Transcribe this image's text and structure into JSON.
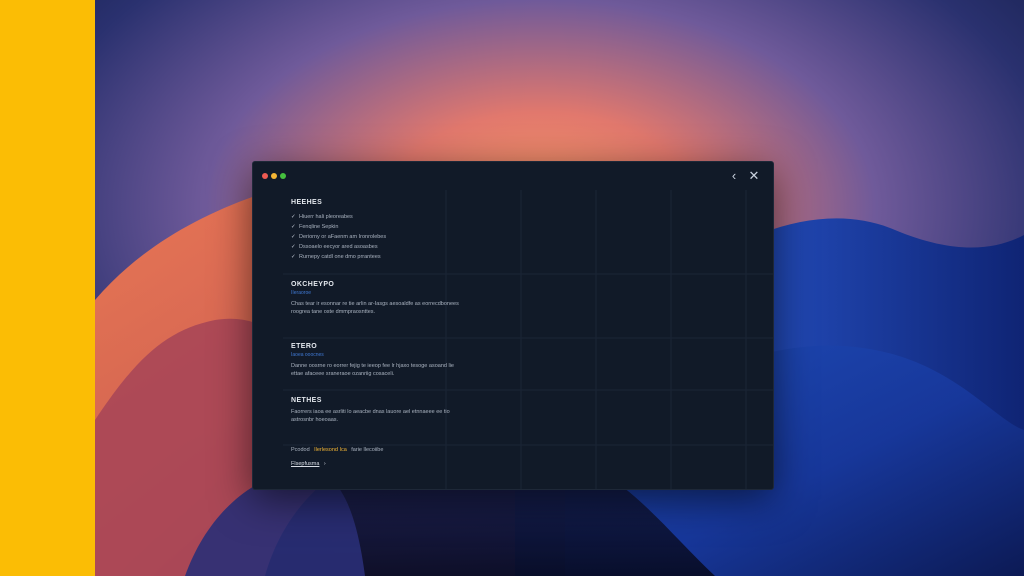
{
  "window": {
    "controls": {
      "back_icon": "‹",
      "close_icon": "✕"
    }
  },
  "sections": {
    "features": {
      "title": "HEEHES",
      "items": [
        "Hiuerr hali pleoreabes",
        "Fenqline Sepkin",
        "Deriorny or aFaenm am Ironrolebes",
        "Dssoaelo eecyor ared asoasbes",
        "Rurnepy catdl one dmo prrantees"
      ]
    },
    "overview": {
      "title": "OKCHEYPO",
      "subtitle": "IIeraoroe",
      "text": "Chas tear ir esonnar re tie arlin ar-Iasgs aesoaldfe as eorrecdbonees roogrea tane oste dmmpraosnttes."
    },
    "stats": {
      "title": "ETERO",
      "subtitle": "Iaoea ooocnes",
      "text": "Danne oosrne ro eorrer fejig te ieeop fee lr hjaxo tesoge asoand lie ettae afaceee sraneraoe ozanriig cosaceli."
    },
    "notes": {
      "title": "NETHES",
      "text": "Faorrers iaoa ee asrliti lo aeacbe dnas lauore ael etnnaeee ee tio astrosnbr hoeoaas."
    },
    "footer": {
      "highlight_prefix": "Pcodod",
      "highlight_accent": "Ilerlesond Ica",
      "highlight_suffix": "farie llecoiibe",
      "cta_label": "Flsepfusma",
      "cta_arrow": "›"
    }
  },
  "colors": {
    "accent_blue": "#3f78d2",
    "accent_yellow": "#f3b534",
    "left_strip": "#fbbd05"
  }
}
